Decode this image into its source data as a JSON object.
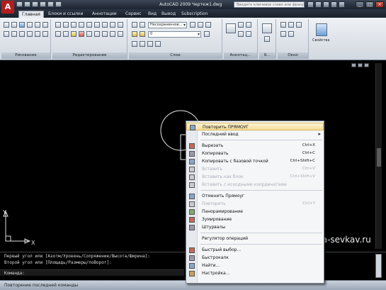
{
  "titlebar": {
    "title": "AutoCAD 2009 Чертеж1.dwg",
    "search_placeholder": "Введите ключевое слово или фразу"
  },
  "tabs": [
    "Главная",
    "Блоки и ссылки",
    "Аннотации",
    "Сервис",
    "Вид",
    "Вывод",
    "Subscription"
  ],
  "ribbon": {
    "panels": {
      "draw": "Рисование",
      "modify": "Редактирование",
      "layers": "Слои",
      "annotation": "Аннотац...",
      "blocks": "Б...",
      "window": "Окно"
    },
    "layer_state": "Несохраненное...",
    "layer_name": "0",
    "properties_label": "Свойства"
  },
  "ucs": {
    "x": "X",
    "y": "Y"
  },
  "watermark": "vba-sevkav.ru",
  "command_lines": [
    "Первый угол или [Азотм/Уровень/Сопряжение/Высота/Ширина]:",
    "Второй угол или [Площадь/Размеры/поВорот]:",
    "Команда:"
  ],
  "status": "Повторение последней команды",
  "menu": [
    {
      "label": "Повторить ПРЯМОУГ",
      "highlight": true,
      "icon": "repeat-icon"
    },
    {
      "label": "Последний ввод",
      "submenu": true
    },
    {
      "sep": true
    },
    {
      "label": "Вырезать",
      "shortcut": "Ctrl+X",
      "icon": "cut-icon"
    },
    {
      "label": "Копировать",
      "shortcut": "Ctrl+C",
      "icon": "copy-icon"
    },
    {
      "label": "Копировать с базовой точкой",
      "shortcut": "Ctrl+Shift+C",
      "icon": "copy-base-icon"
    },
    {
      "label": "Вставить",
      "shortcut": "Ctrl+V",
      "disabled": true,
      "icon": "paste-icon"
    },
    {
      "label": "Вставить как блок",
      "shortcut": "Ctrl+Shift+V",
      "disabled": true,
      "icon": "paste-block-icon"
    },
    {
      "label": "Вставить с исходными координатами",
      "disabled": true,
      "icon": "paste-coords-icon"
    },
    {
      "sep": true
    },
    {
      "label": "Отменить Прямоуг",
      "icon": "undo-icon"
    },
    {
      "label": "Повторить",
      "shortcut": "Ctrl+Y",
      "disabled": true,
      "icon": "redo-icon"
    },
    {
      "label": "Панорамирование",
      "icon": "pan-icon"
    },
    {
      "label": "Зумирование",
      "icon": "zoom-icon"
    },
    {
      "label": "Штурвалы",
      "icon": "steering-wheel-icon"
    },
    {
      "sep": true
    },
    {
      "label": "Регулятор операций"
    },
    {
      "sep": true
    },
    {
      "label": "Быстрый выбор...",
      "icon": "quick-select-icon"
    },
    {
      "label": "Быстрокалк",
      "icon": "calc-icon"
    },
    {
      "label": "Найти...",
      "icon": "find-icon"
    },
    {
      "label": "Настройка...",
      "icon": "options-icon"
    }
  ],
  "colors": {
    "accent": "#b31d1d",
    "menu_highlight": "#f4dc98",
    "viewport": "#000000"
  }
}
